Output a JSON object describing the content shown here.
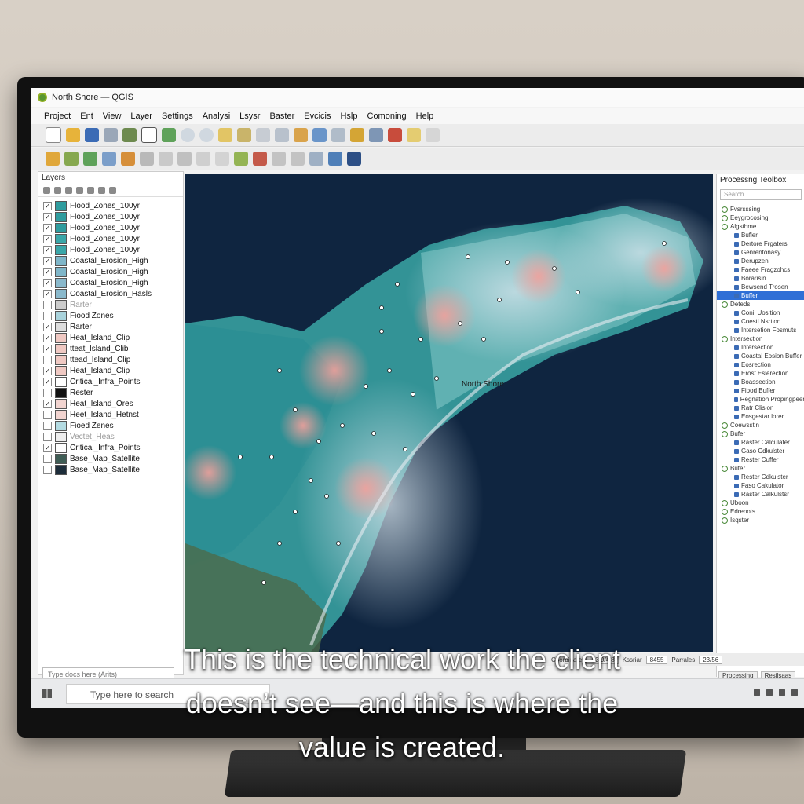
{
  "window": {
    "title": "North Shore — QGIS"
  },
  "menu": [
    "Project",
    "Ent",
    "View",
    "Layer",
    "Settings",
    "Analysi",
    "Lsysr",
    "Baster",
    "Evcicis",
    "Hslp",
    "Comoning",
    "Help"
  ],
  "layers_panel": {
    "title": "Layers",
    "search_placeholder": "Type docs here (Arits)",
    "items": [
      {
        "label": "Flood_Zones_100yr",
        "checked": true,
        "color": "#2f9c9e"
      },
      {
        "label": "Flood_Zones_100yr",
        "checked": true,
        "color": "#2f9c9e"
      },
      {
        "label": "Flood_Zones_100yr",
        "checked": true,
        "color": "#2f9c9e"
      },
      {
        "label": "Flood_Zones_100yr",
        "checked": true,
        "color": "#3aa6a8"
      },
      {
        "label": "Flood_Zones_100yr",
        "checked": true,
        "color": "#3aa6a8"
      },
      {
        "label": "Coastal_Erosion_High",
        "checked": true,
        "color": "#7fb6c9"
      },
      {
        "label": "Coastal_Erosion_High",
        "checked": true,
        "color": "#7fb6c9"
      },
      {
        "label": "Coastal_Erosion_High",
        "checked": true,
        "color": "#8ab9cc"
      },
      {
        "label": "Coastal_Erosion_Hasls",
        "checked": true,
        "color": "#8ab9cc"
      },
      {
        "label": "Rarter",
        "checked": false,
        "color": "#cccccc",
        "dim": true
      },
      {
        "label": "Fiood Zones",
        "checked": false,
        "color": "#a9d3dc",
        "dim": false
      },
      {
        "label": "Rarter",
        "checked": true,
        "color": "#dddddd",
        "dim": false
      },
      {
        "label": "Heat_Island_Clip",
        "checked": true,
        "color": "#f0c9c3"
      },
      {
        "label": "tteat_Island_Clib",
        "checked": true,
        "color": "#f0c9c3"
      },
      {
        "label": "ttead_Island_Clip",
        "checked": false,
        "color": "#f0c9c3"
      },
      {
        "label": "Heat_Island_Clip",
        "checked": true,
        "color": "#f0c9c3"
      },
      {
        "label": "Critical_Infra_Points",
        "checked": true,
        "color": "#ffffff"
      },
      {
        "label": "Rester",
        "checked": false,
        "color": "#111111"
      },
      {
        "label": "Heat_Island_Ores",
        "checked": true,
        "color": "#f2d4d0"
      },
      {
        "label": "Heet_Island_Hetnst",
        "checked": false,
        "color": "#f2d4d0"
      },
      {
        "label": "Fioed Zenes",
        "checked": false,
        "color": "#b3dbe2"
      },
      {
        "label": "Vectet_Heas",
        "checked": false,
        "color": "#eeeeee",
        "dim": true
      },
      {
        "label": "Critical_Infra_Points",
        "checked": true,
        "color": "#ffffff"
      },
      {
        "label": "Base_Map_Satellite",
        "checked": false,
        "color": "#3f5d55"
      },
      {
        "label": "Base_Map_Satellite",
        "checked": false,
        "color": "#1d2d3a"
      }
    ]
  },
  "map": {
    "label": "North Shore"
  },
  "toolbox": {
    "title": "Processng Teolbox",
    "search_placeholder": "Search...",
    "tree": [
      {
        "label": "Fvsrsssing",
        "level": 0
      },
      {
        "label": "Eeygrocosing",
        "level": 0
      },
      {
        "label": "Algsthme",
        "level": 0
      },
      {
        "label": "Bufler",
        "level": 1
      },
      {
        "label": "Dertore Frgaters",
        "level": 1
      },
      {
        "label": "Genrentonasy",
        "level": 1
      },
      {
        "label": "Derupzen",
        "level": 1
      },
      {
        "label": "Faeee Fragzohcs",
        "level": 1
      },
      {
        "label": "Borarisin",
        "level": 1
      },
      {
        "label": "Bewsend Trosen",
        "level": 1
      },
      {
        "label": "Buffer",
        "level": 1,
        "selected": true
      },
      {
        "label": "Deteds",
        "level": 0
      },
      {
        "label": "Conil Uosition",
        "level": 1
      },
      {
        "label": "Coestl Nsrtion",
        "level": 1
      },
      {
        "label": "Intersetion Fosmuts",
        "level": 1
      },
      {
        "label": "Intersection",
        "level": 0
      },
      {
        "label": "Intersection",
        "level": 1
      },
      {
        "label": "Coastal Eosion Buffer",
        "level": 1
      },
      {
        "label": "Eosrection",
        "level": 1
      },
      {
        "label": "Erost Eslerection",
        "level": 1
      },
      {
        "label": "Boassection",
        "level": 1
      },
      {
        "label": "Fiood Buffer",
        "level": 1
      },
      {
        "label": "Regnation Propingpeer",
        "level": 1
      },
      {
        "label": "Ratr Clision",
        "level": 1
      },
      {
        "label": "Eosgestar lorer",
        "level": 1
      },
      {
        "label": "Coewsstin",
        "level": 0
      },
      {
        "label": "Bufer",
        "level": 0
      },
      {
        "label": "Raster Calculater",
        "level": 1
      },
      {
        "label": "Gaso Cdkulster",
        "level": 1
      },
      {
        "label": "Rester Cuffer",
        "level": 1
      },
      {
        "label": "Buter",
        "level": 0
      },
      {
        "label": "Rester Cdkulster",
        "level": 1
      },
      {
        "label": "Faso Cakulator",
        "level": 1
      },
      {
        "label": "Raster Calkulstsr",
        "level": 1
      },
      {
        "label": "Uboon",
        "level": 0
      },
      {
        "label": "Edrenots",
        "level": 0
      },
      {
        "label": "Isqster",
        "level": 0
      }
    ],
    "tabs": [
      "Processing",
      "Resilsaas"
    ]
  },
  "statusbar": {
    "coord_label": "Coordinate",
    "coord_value": "-83/0/4/8",
    "scale_label": "Kssriar",
    "scale_value": "8455",
    "rotation_label": "Parrales",
    "rotation_value": "23/56"
  },
  "taskbar": {
    "search_placeholder": "Type here to search"
  },
  "caption": {
    "line1": "This is the technical work the client",
    "line2": "doesn’t see—and this is where the",
    "line3": "value is created."
  },
  "colors": {
    "qgis_green": "#589632",
    "selection": "#2f6fd6",
    "map_sea": "#0f2540",
    "flood": "#45b7b5",
    "heat": "#f1a3a0"
  }
}
